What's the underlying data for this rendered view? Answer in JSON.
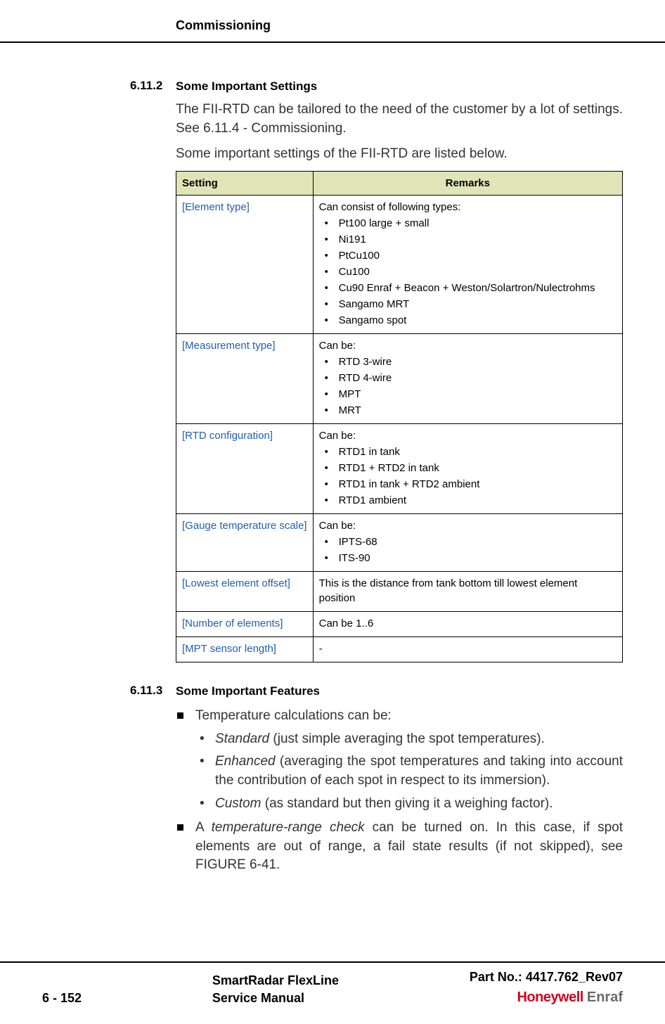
{
  "header": {
    "title": "Commissioning"
  },
  "section1": {
    "num": "6.11.2",
    "title": "Some Important Settings",
    "p1": "The FII-RTD can be tailored to the need of the customer by a lot of settings. See 6.11.4 - Commissioning.",
    "p2": "Some important settings of the FII-RTD are listed below."
  },
  "table": {
    "head": {
      "c1": "Setting",
      "c2": "Remarks"
    },
    "rows": [
      {
        "name": "[Element type]",
        "lead": "Can consist of following types:",
        "items": [
          "Pt100 large + small",
          "Ni191",
          "PtCu100",
          "Cu100",
          "Cu90 Enraf + Beacon + Weston/Solartron/Nulectrohms",
          "Sangamo MRT",
          "Sangamo spot"
        ]
      },
      {
        "name": "[Measurement type]",
        "lead": "Can be:",
        "items": [
          "RTD 3-wire",
          "RTD 4-wire",
          "MPT",
          "MRT"
        ]
      },
      {
        "name": "[RTD configuration]",
        "lead": "Can be:",
        "items": [
          "RTD1 in tank",
          "RTD1 + RTD2 in tank",
          "RTD1 in tank + RTD2 ambient",
          "RTD1 ambient"
        ]
      },
      {
        "name": "[Gauge temperature scale]",
        "lead": "Can be:",
        "items": [
          "IPTS-68",
          "ITS-90"
        ]
      },
      {
        "name": "[Lowest element offset]",
        "lead": "This is the distance from tank bottom till lowest element position",
        "items": []
      },
      {
        "name": "[Number of elements]",
        "lead": "Can be 1..6",
        "items": []
      },
      {
        "name": "[MPT sensor length]",
        "lead": "-",
        "items": []
      }
    ]
  },
  "section2": {
    "num": "6.11.3",
    "title": "Some Important Features",
    "bullet1": "Temperature calculations can be:",
    "sub": [
      {
        "em": "Standard",
        "rest": " (just simple averaging the spot temperatures)."
      },
      {
        "em": "Enhanced",
        "rest": " (averaging the spot temperatures and taking into account the contribution of each spot in respect to its immersion)."
      },
      {
        "em": "Custom",
        "rest": " (as standard but then giving it a weighing factor)."
      }
    ],
    "bullet2_pre": "A ",
    "bullet2_em": "temperature-range check",
    "bullet2_post": " can be turned on. In this case, if spot elements are out of range, a fail state results (if not skipped), see FIGURE 6-41."
  },
  "footer": {
    "page": "6 - 152",
    "mid1": "SmartRadar FlexLine",
    "mid2": "Service Manual",
    "part": "Part No.: 4417.762_Rev07",
    "logo1": "Honeywell",
    "logo2": "Enraf"
  }
}
